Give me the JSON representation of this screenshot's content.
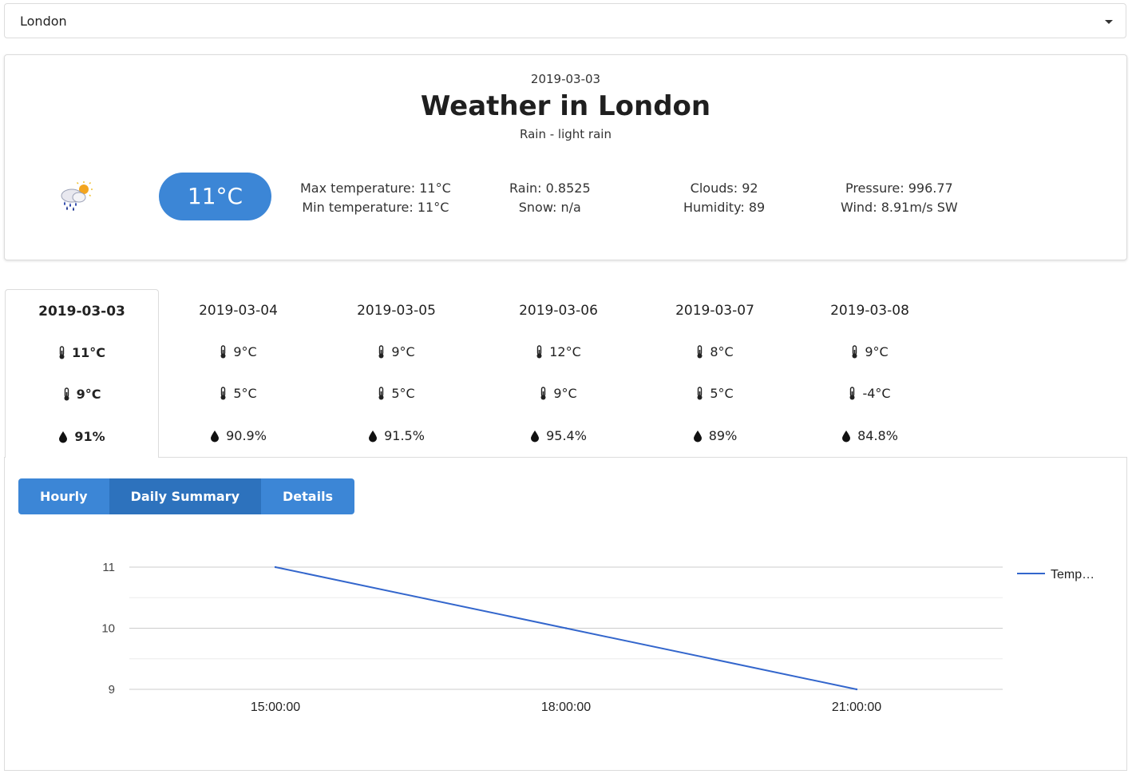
{
  "city_select": {
    "value": "London"
  },
  "current": {
    "date": "2019-03-03",
    "title": "Weather in London",
    "description": "Rain - light rain",
    "icon": "rain-sun-cloud-icon",
    "temperature": "11°C",
    "max_temp": "Max temperature: 11°C",
    "min_temp": "Min temperature: 11°C",
    "rain": "Rain: 0.8525",
    "snow": "Snow: n/a",
    "clouds": "Clouds: 92",
    "humidity": "Humidity: 89",
    "pressure": "Pressure: 996.77",
    "wind": "Wind: 8.91m/s SW",
    "accent_color": "#3c86d6"
  },
  "days": [
    {
      "date": "2019-03-03",
      "max": "11°C",
      "min": "9°C",
      "humidity": "91%"
    },
    {
      "date": "2019-03-04",
      "max": "9°C",
      "min": "5°C",
      "humidity": "90.9%"
    },
    {
      "date": "2019-03-05",
      "max": "9°C",
      "min": "5°C",
      "humidity": "91.5%"
    },
    {
      "date": "2019-03-06",
      "max": "12°C",
      "min": "9°C",
      "humidity": "95.4%"
    },
    {
      "date": "2019-03-07",
      "max": "8°C",
      "min": "5°C",
      "humidity": "89%"
    },
    {
      "date": "2019-03-08",
      "max": "9°C",
      "min": "-4°C",
      "humidity": "84.8%"
    }
  ],
  "view_tabs": [
    {
      "label": "Hourly"
    },
    {
      "label": "Daily Summary",
      "active": true
    },
    {
      "label": "Details"
    }
  ],
  "chart_data": {
    "type": "line",
    "categories": [
      "15:00:00",
      "18:00:00",
      "21:00:00"
    ],
    "series": [
      {
        "name": "Temp…",
        "values": [
          11,
          10,
          9
        ],
        "color": "#3366cc"
      }
    ],
    "ylim": [
      9,
      11
    ],
    "yticks": [
      9,
      10,
      11
    ],
    "grid": true,
    "legend": "right"
  }
}
